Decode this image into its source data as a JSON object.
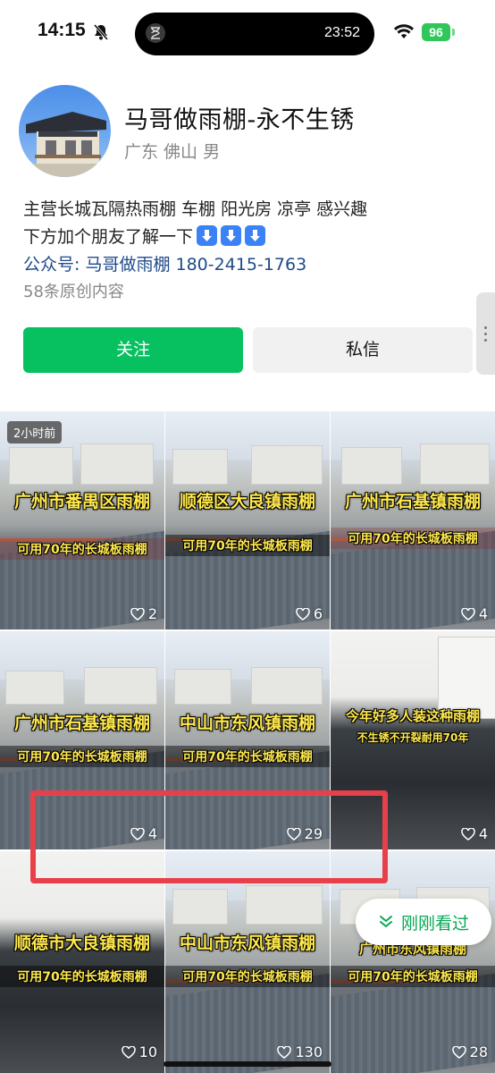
{
  "status": {
    "time": "14:15",
    "island_time": "23:52",
    "battery": "96"
  },
  "profile": {
    "name": "马哥做雨棚-永不生锈",
    "location": "广东 佛山 男",
    "bio_line1": "主营长城瓦隔热雨棚 车棚 阳光房 凉亭 感兴趣",
    "bio_line2": "下方加个朋友了解一下",
    "public_account": "公众号: 马哥做雨棚 180-2415-1763",
    "original_count": "58条原创内容"
  },
  "actions": {
    "follow": "关注",
    "message": "私信"
  },
  "videos": [
    {
      "title": "广州市番禺区雨棚",
      "subtitle": "可用70年的长城板雨棚",
      "likes": "2",
      "badge": "2小时前"
    },
    {
      "title": "顺德区大良镇雨棚",
      "subtitle": "可用70年的长城板雨棚",
      "likes": "6"
    },
    {
      "title": "广州市石基镇雨棚",
      "subtitle": "可用70年的长城板雨棚",
      "likes": "4"
    },
    {
      "title": "广州市石基镇雨棚",
      "subtitle": "可用70年的长城板雨棚",
      "likes": "4"
    },
    {
      "title": "中山市东风镇雨棚",
      "subtitle": "可用70年的长城板雨棚",
      "likes": "29"
    },
    {
      "title": "今年好多人装这种雨棚",
      "subtitle": "不生锈不开裂耐用70年",
      "likes": "4"
    },
    {
      "title": "顺德市大良镇雨棚",
      "subtitle": "可用70年的长城板雨棚",
      "likes": "10"
    },
    {
      "title": "中山市东风镇雨棚",
      "subtitle": "可用70年的长城板雨棚",
      "likes": "130"
    },
    {
      "title": "广州市东风镇雨棚",
      "subtitle": "可用70年的长城板雨棚",
      "likes": "28"
    }
  ],
  "floating": {
    "recent": "刚刚看过"
  },
  "colors": {
    "accent_green": "#07c160",
    "link_blue": "#1e4a8a",
    "highlight_red": "#e8404b"
  }
}
